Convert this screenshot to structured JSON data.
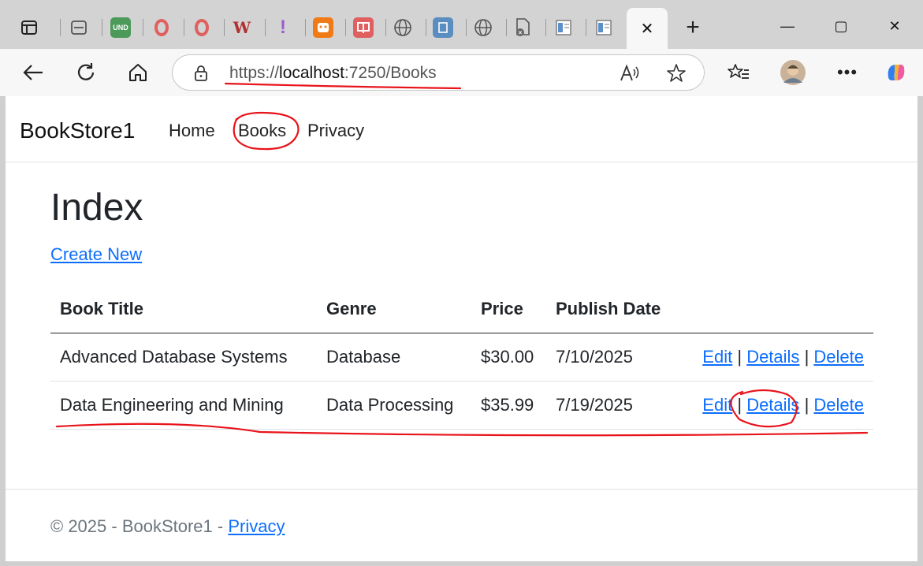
{
  "browser": {
    "tabs": [
      {
        "icon": "sidebar-icon"
      },
      {
        "icon": "tab-actions-icon"
      },
      {
        "icon": "und-tab-icon",
        "text": "UND"
      },
      {
        "icon": "opera-tab-icon"
      },
      {
        "icon": "opera-tab-icon"
      },
      {
        "icon": "wordpress-tab-icon"
      },
      {
        "icon": "purple-exclamation-icon"
      },
      {
        "icon": "orange-app-tab-icon"
      },
      {
        "icon": "red-app-tab-icon"
      },
      {
        "icon": "globe-icon"
      },
      {
        "icon": "blue-doc-tab-icon"
      },
      {
        "icon": "globe-icon"
      },
      {
        "icon": "file-settings-icon"
      },
      {
        "icon": "document-tab-icon"
      },
      {
        "icon": "document-tab-icon"
      }
    ],
    "active_tab_close": "✕",
    "new_tab": "+",
    "window_controls": {
      "minimize": "—",
      "maximize": "▢",
      "close": "✕"
    },
    "address": {
      "scheme": "https://",
      "host": "localhost",
      "rest": ":7250/Books"
    },
    "avatar_present": true
  },
  "site": {
    "brand": "BookStore1",
    "nav": [
      "Home",
      "Books",
      "Privacy"
    ]
  },
  "main": {
    "heading": "Index",
    "create_link": "Create New",
    "table": {
      "headers": [
        "Book Title",
        "Genre",
        "Price",
        "Publish Date"
      ],
      "rows": [
        {
          "title": "Advanced Database Systems",
          "genre": "Database",
          "price": "$30.00",
          "date": "7/10/2025",
          "actions": [
            "Edit",
            "Details",
            "Delete"
          ]
        },
        {
          "title": "Data Engineering and Mining",
          "genre": "Data Processing",
          "price": "$35.99",
          "date": "7/19/2025",
          "actions": [
            "Edit",
            "Details",
            "Delete"
          ]
        }
      ],
      "action_separator": "|"
    }
  },
  "footer": {
    "text": "© 2025 - BookStore1 - ",
    "link": "Privacy"
  },
  "colors": {
    "link": "#0d6efd",
    "annotation": "#e8141b",
    "text": "#212529",
    "muted": "#6c757d"
  }
}
